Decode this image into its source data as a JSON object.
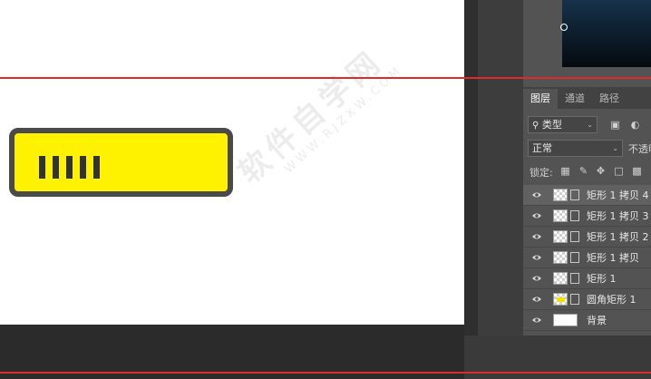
{
  "canvas": {
    "progress": {
      "filled_ticks": 5
    }
  },
  "watermark": {
    "main": "软件自学网",
    "sub": "WWW.RJZXW.COM"
  },
  "layers_panel": {
    "tabs": [
      {
        "label": "图层",
        "active": true
      },
      {
        "label": "通道",
        "active": false
      },
      {
        "label": "路径",
        "active": false
      }
    ],
    "filter_label": "类型",
    "blend_mode": "正常",
    "opacity_label": "不透明",
    "lock_label": "锁定:",
    "layers": [
      {
        "name": "矩形 1 拷贝 4",
        "thumb": "transparent",
        "linked": true,
        "selected": true
      },
      {
        "name": "矩形 1 拷贝 3",
        "thumb": "transparent",
        "linked": true,
        "selected": false
      },
      {
        "name": "矩形 1 拷贝 2",
        "thumb": "transparent",
        "linked": true,
        "selected": false
      },
      {
        "name": "矩形 1 拷贝",
        "thumb": "transparent",
        "linked": true,
        "selected": false
      },
      {
        "name": "矩形 1",
        "thumb": "transparent",
        "linked": true,
        "selected": false
      },
      {
        "name": "圆角矩形 1",
        "thumb": "yellow",
        "linked": true,
        "selected": false
      },
      {
        "name": "背景",
        "thumb": "white",
        "linked": false,
        "selected": false
      }
    ]
  },
  "colors": {
    "guide": "#e0282d",
    "progress_fill": "#fff200",
    "progress_border": "#4a4a4a",
    "tick": "#333333"
  }
}
